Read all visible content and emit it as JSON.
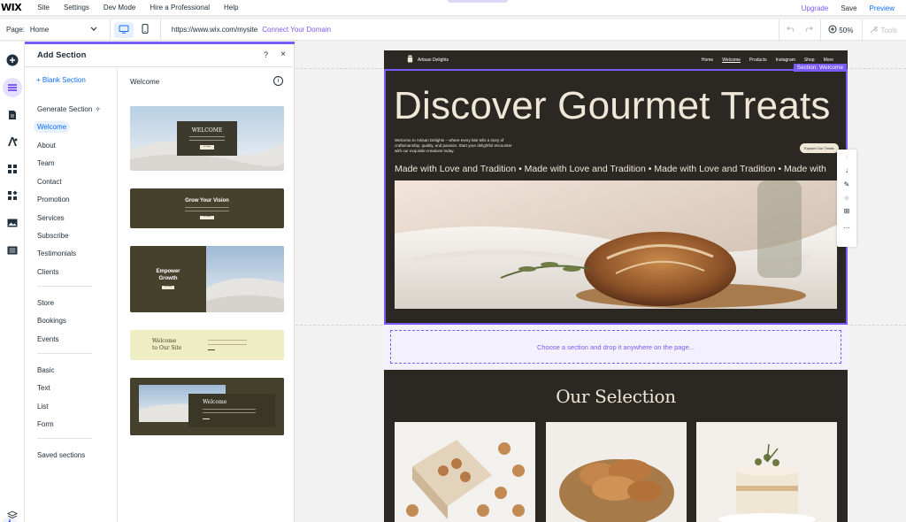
{
  "topbar": {
    "logo": "WIX",
    "menu": [
      "Site",
      "Settings",
      "Dev Mode",
      "Hire a Professional",
      "Help"
    ],
    "upgrade": "Upgrade",
    "save": "Save",
    "preview": "Preview"
  },
  "subbar": {
    "page_label": "Page:",
    "page_value": "Home",
    "url": "https://www.wix.com/mysite",
    "connect_domain": "Connect Your Domain",
    "zoom": "50%",
    "tools": "Tools"
  },
  "panel": {
    "title": "Add Section",
    "help": "?",
    "close": "×",
    "blank_section": "+ Blank Section",
    "generate_section": "Generate Section",
    "categories_group1": [
      "Welcome",
      "About",
      "Team",
      "Contact",
      "Promotion",
      "Services",
      "Subscribe",
      "Testimonials",
      "Clients"
    ],
    "categories_group2": [
      "Store",
      "Bookings",
      "Events"
    ],
    "categories_group3": [
      "Basic",
      "Text",
      "List",
      "Form"
    ],
    "saved_sections": "Saved sections",
    "selected_category": "Welcome",
    "preview_title": "Welcome",
    "info": "i",
    "cards": [
      {
        "title": "WELCOME",
        "button": "Get Started"
      },
      {
        "title": "Grow Your Vision",
        "button": "Get Started"
      },
      {
        "title": "Empower Growth",
        "button": "Get Started"
      },
      {
        "title_line1": "Welcome",
        "title_line2": "to Our Site"
      },
      {
        "title": "Welcome"
      }
    ]
  },
  "site": {
    "brand": "Artisan Delights",
    "nav": [
      "Home",
      "Welcome",
      "Products",
      "Instagram",
      "Shop",
      "More"
    ],
    "section_label": "Section: Welcome",
    "hero_title": "Discover Gourmet Treats",
    "hero_text": "Welcome to Artisan Delights – where every bite tells a story of craftsmanship, quality, and passion. Start your delightful encounter with our exquisite creations today.",
    "explore_button": "Explore Our Treats",
    "marquee": "Made with Love and Tradition  •  Made with Love and Tradition  •  Made with Love and Tradition  •  Made with",
    "drop_text": "Choose a section and drop it anywhere on the page...",
    "selection_heading": "Our Selection"
  },
  "colors": {
    "accent": "#7a5af8",
    "link": "#116dff",
    "site_bg": "#2b2823",
    "site_text": "#efe7d7"
  }
}
